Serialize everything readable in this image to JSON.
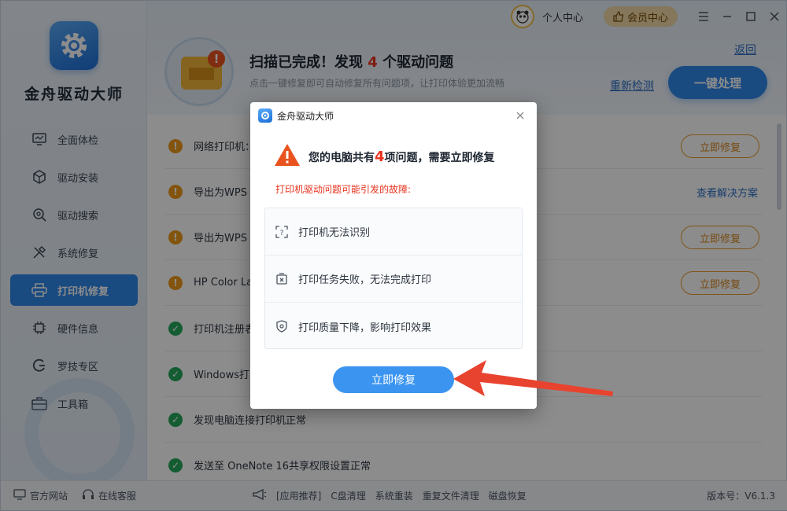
{
  "app": {
    "name": "金舟驱动大师"
  },
  "sidebar": {
    "items": [
      {
        "label": "全面体检",
        "icon": "monitor-icon"
      },
      {
        "label": "驱动安装",
        "icon": "package-icon"
      },
      {
        "label": "驱动搜索",
        "icon": "search-gear-icon"
      },
      {
        "label": "系统修复",
        "icon": "tools-icon"
      },
      {
        "label": "打印机修复",
        "icon": "printer-icon",
        "active": true
      },
      {
        "label": "硬件信息",
        "icon": "chip-icon"
      },
      {
        "label": "罗技专区",
        "icon": "logitech-icon"
      },
      {
        "label": "工具箱",
        "icon": "toolbox-icon"
      }
    ]
  },
  "topbar": {
    "user_center": "个人中心",
    "vip_center": "会员中心"
  },
  "header": {
    "title_prefix": "扫描已完成！发现 ",
    "issue_count": "4",
    "title_suffix": " 个驱动问题",
    "subtitle": "点击一键修复即可自动修复所有问题项，让打印体验更加流畅",
    "back": "返回",
    "recheck": "重新检测",
    "fix_all": "一键处理"
  },
  "list": {
    "rows": [
      {
        "text": "网络打印机：",
        "status": "warn",
        "action": "立即修复",
        "action_type": "button"
      },
      {
        "text": "导出为WPS",
        "status": "warn",
        "action": "查看解决方案",
        "action_type": "link"
      },
      {
        "text": "导出为WPS",
        "status": "warn",
        "action": "立即修复",
        "action_type": "button"
      },
      {
        "text": "HP Color La",
        "status": "warn",
        "action": "立即修复",
        "action_type": "button"
      },
      {
        "text": "打印机注册表",
        "status": "ok"
      },
      {
        "text": "Windows打印",
        "status": "ok"
      },
      {
        "text": "发现电脑连接打印机正常",
        "status": "ok"
      },
      {
        "text": "发送至 OneNote 16共享权限设置正常",
        "status": "ok"
      }
    ]
  },
  "footer": {
    "website": "官方网站",
    "support": "在线客服",
    "apps": [
      "[应用推荐]",
      "C盘清理",
      "系统重装",
      "重复文件清理",
      "磁盘恢复"
    ],
    "version": "版本号：V6.1.3"
  },
  "modal": {
    "title": "金舟驱动大师",
    "head_prefix": "您的电脑共有",
    "head_count": "4",
    "head_suffix": "项问题，需要立即修复",
    "note": "打印机驱动问题可能引发的故障:",
    "items": [
      {
        "label": "打印机无法识别",
        "icon": "unknown-device-icon"
      },
      {
        "label": "打印任务失败，无法完成打印",
        "icon": "print-fail-icon"
      },
      {
        "label": "打印质量下降，影响打印效果",
        "icon": "quality-shield-icon"
      }
    ],
    "button": "立即修复"
  },
  "colors": {
    "accent": "#2f87ea",
    "warning": "#ef9a18",
    "ok": "#25a85a",
    "alert": "#e8321d",
    "arrow": "#e8432f"
  }
}
